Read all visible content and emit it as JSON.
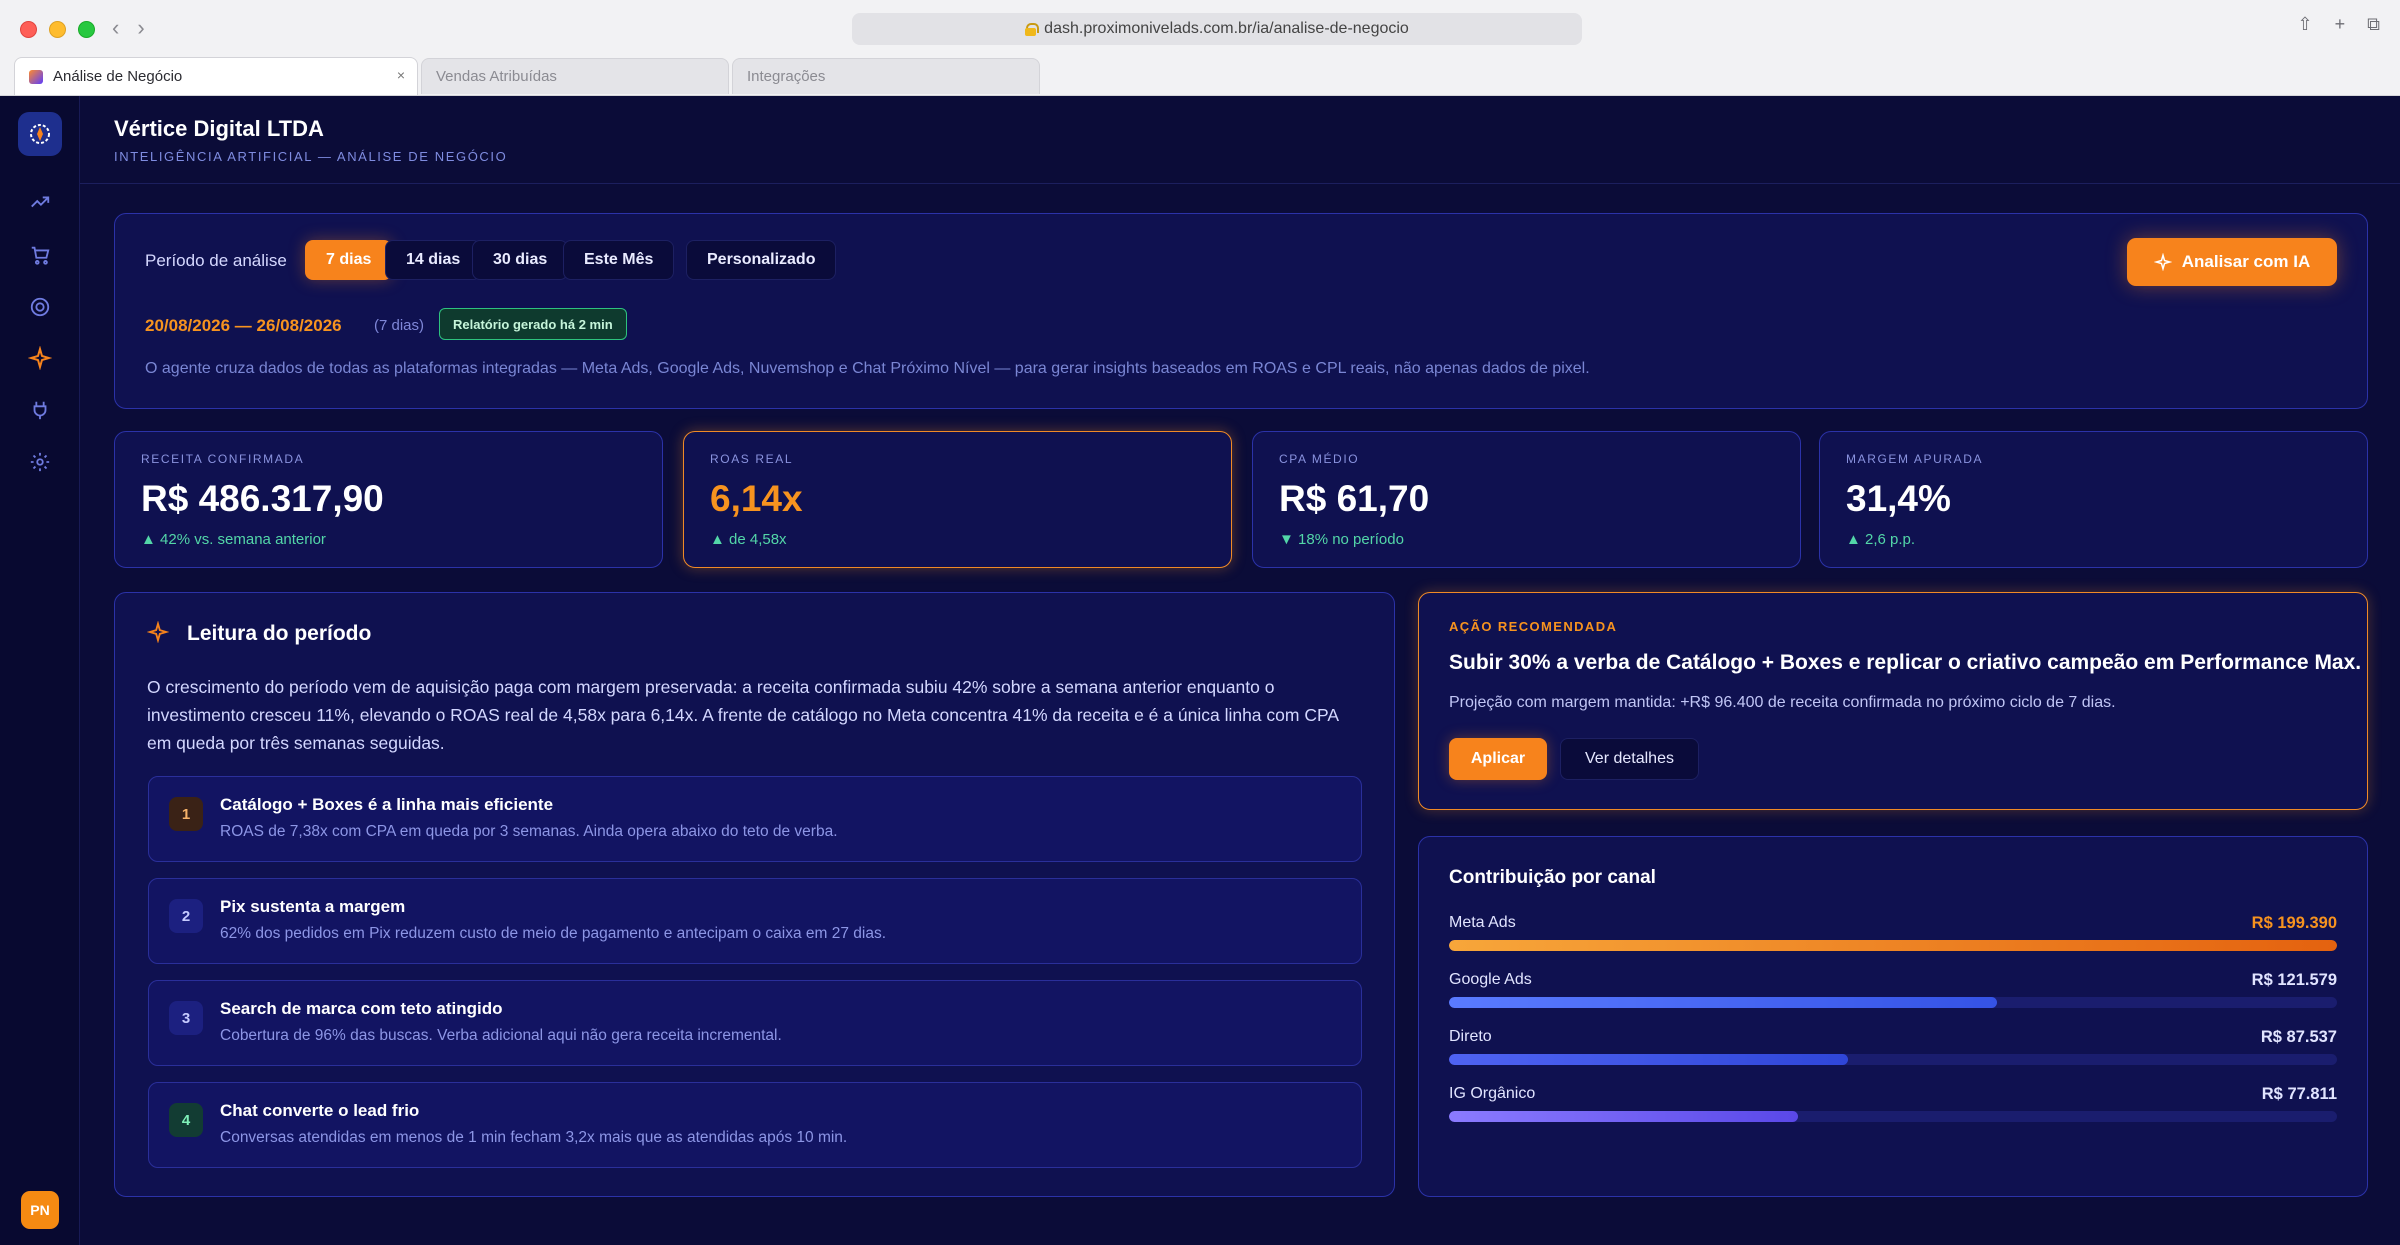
{
  "browser": {
    "url": "dash.proximonivelads.com.br/ia/analise-de-negocio",
    "tabs": [
      {
        "label": "Análise de Negócio"
      },
      {
        "label": "Vendas Atribuídas"
      },
      {
        "label": "Integrações"
      }
    ]
  },
  "sidebar": {
    "avatar_initials": "PN",
    "items": [
      {
        "icon": "trending-up-icon"
      },
      {
        "icon": "cart-icon"
      },
      {
        "icon": "target-icon"
      },
      {
        "icon": "sparkle-icon"
      },
      {
        "icon": "plug-icon"
      },
      {
        "icon": "gear-icon"
      }
    ]
  },
  "header": {
    "company": "Vértice Digital LTDA",
    "subtitle": "INTELIGÊNCIA ARTIFICIAL — ANÁLISE DE NEGÓCIO"
  },
  "period": {
    "label": "Período de análise",
    "options": [
      "7 dias",
      "14 dias",
      "30 dias",
      "Este Mês",
      "Personalizado"
    ],
    "selected": "7 dias",
    "analyze_label": "Analisar com IA",
    "date_range": "20/08/2026 — 26/08/2026",
    "days_note": "(7 dias)",
    "report_badge": "Relatório gerado há 2 min",
    "description": "O agente cruza dados de todas as plataformas integradas — Meta Ads, Google Ads, Nuvemshop e Chat Próximo Nível — para gerar insights baseados em ROAS e CPL reais, não apenas dados de pixel."
  },
  "kpis": [
    {
      "label": "RECEITA CONFIRMADA",
      "value": "R$ 486.317,90",
      "delta": "▲ 42% vs. semana anterior"
    },
    {
      "label": "ROAS REAL",
      "value": "6,14x",
      "delta": "▲ de 4,58x"
    },
    {
      "label": "CPA MÉDIO",
      "value": "R$ 61,70",
      "delta": "▼ 18% no período"
    },
    {
      "label": "MARGEM APURADA",
      "value": "31,4%",
      "delta": "▲ 2,6 p.p."
    }
  ],
  "reading": {
    "title": "Leitura do período",
    "text": "O crescimento do período vem de aquisição paga com margem preservada: a receita confirmada subiu 42% sobre a semana anterior enquanto o investimento cresceu 11%, elevando o ROAS real de 4,58x para 6,14x. A frente de catálogo no Meta concentra 41% da receita e é a única linha com CPA em queda por três semanas seguidas.",
    "insights": [
      {
        "num": "1",
        "title": "Catálogo + Boxes é a linha mais eficiente",
        "desc": "ROAS de 7,38x com CPA em queda por 3 semanas. Ainda opera abaixo do teto de verba."
      },
      {
        "num": "2",
        "title": "Pix sustenta a margem",
        "desc": "62% dos pedidos em Pix reduzem custo de meio de pagamento e antecipam o caixa em 27 dias."
      },
      {
        "num": "3",
        "title": "Search de marca com teto atingido",
        "desc": "Cobertura de 96% das buscas. Verba adicional aqui não gera receita incremental."
      },
      {
        "num": "4",
        "title": "Chat converte o lead frio",
        "desc": "Conversas atendidas em menos de 1 min fecham 3,2x mais que as atendidas após 10 min."
      }
    ]
  },
  "action": {
    "label": "AÇÃO RECOMENDADA",
    "title": "Subir 30% a verba de Catálogo + Boxes e replicar o criativo campeão em Performance Max.",
    "desc": "Projeção com margem mantida: +R$ 96.400 de receita confirmada no próximo ciclo de 7 dias.",
    "apply_label": "Aplicar",
    "details_label": "Ver detalhes"
  },
  "channels": {
    "title": "Contribuição por canal",
    "items": [
      {
        "name": "Meta Ads",
        "value": "R$ 199.390",
        "share": 1.0
      },
      {
        "name": "Google Ads",
        "value": "R$ 121.579",
        "share": 0.617
      },
      {
        "name": "Direto",
        "value": "R$ 87.537",
        "share": 0.449
      },
      {
        "name": "IG Orgânico",
        "value": "R$ 77.811",
        "share": 0.393
      }
    ]
  },
  "colors": {
    "accent": "#f7831c",
    "background": "#0b0c38",
    "card": "#0f1150",
    "positive": "#53d6a8"
  }
}
